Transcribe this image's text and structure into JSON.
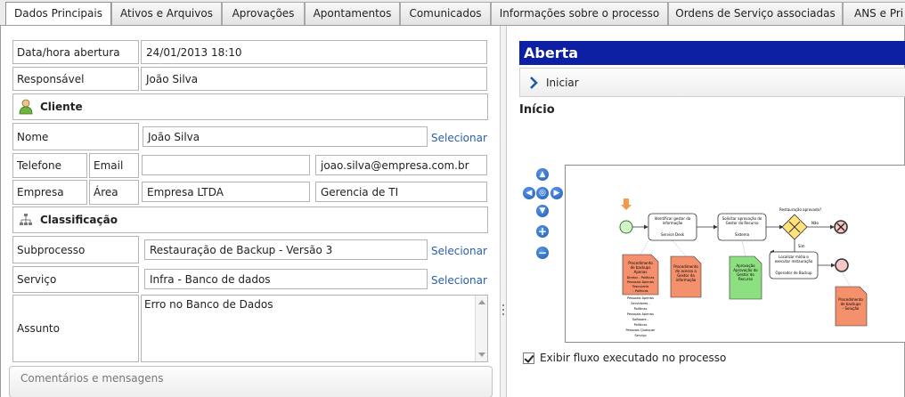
{
  "tabs": [
    {
      "label": "Dados Principais",
      "active": true
    },
    {
      "label": "Ativos e Arquivos"
    },
    {
      "label": "Aprovações"
    },
    {
      "label": "Apontamentos"
    },
    {
      "label": "Comunicados"
    },
    {
      "label": "Informações sobre o processo"
    },
    {
      "label": "Ordens de Serviço associadas"
    },
    {
      "label": "ANS e Pri"
    }
  ],
  "form": {
    "opened_label": "Data/hora abertura",
    "opened_value": "24/01/2013 18:10",
    "owner_label": "Responsável",
    "owner_value": "João Silva",
    "client_section": "Cliente",
    "name_label": "Nome",
    "name_value": "João Silva",
    "phone_label": "Telefone",
    "phone_value": "",
    "email_label": "Email",
    "email_value": "joao.silva@empresa.com.br",
    "company_label": "Empresa",
    "company_value": "Empresa LTDA",
    "area_label": "Área",
    "area_value": "Gerencia de TI",
    "class_section": "Classificação",
    "subprocess_label": "Subprocesso",
    "subprocess_value": "Restauração de Backup - Versão 3",
    "service_label": "Serviço",
    "service_value": "Infra - Banco de dados",
    "subject_label": "Assunto",
    "subject_value": "Erro no Banco de Dados",
    "select_label": "Selecionar",
    "comments_label": "Comentários e mensagens"
  },
  "workflow": {
    "state": "Aberta",
    "action": "Iniciar",
    "step": "Início",
    "show_flow_label": "Exibir fluxo executado no processo",
    "show_flow_checked": true,
    "diagram": {
      "task1": [
        "Identificar gestor da",
        "informação",
        "",
        "Service Desk"
      ],
      "task2": [
        "Solicitar aprovação do",
        "Gestor do Recurso",
        "",
        "Sistema"
      ],
      "task3": [
        "Localizar mídia e",
        "executar restauração",
        "",
        "Operador de Backup"
      ],
      "gateway_label": "Restauração aprovada?",
      "yes_label": "Sim",
      "no_label": "Não",
      "doc1": [
        "Procedimento",
        "de backups",
        "Apenas"
      ],
      "doc1_note": [
        "Diretor  - Políticas",
        "Pessoais   Apenas",
        "Tesouraria",
        "- Políticas",
        "Pessoais  Apenas",
        "Servidores  -",
        "Políticas",
        "Pessoais  Apenas",
        "Software  -",
        "Políticas",
        "Pessoais  Qualquer",
        "Serviço"
      ],
      "doc2": [
        "Procedimento",
        "de acesso a",
        "Gestor da",
        "informação"
      ],
      "doc3": [
        "Aprovação",
        "Aprovação do",
        "Gestor do",
        "Recurso"
      ],
      "doc4": [
        "Procedimento",
        "de backups",
        "- Solução"
      ]
    }
  }
}
